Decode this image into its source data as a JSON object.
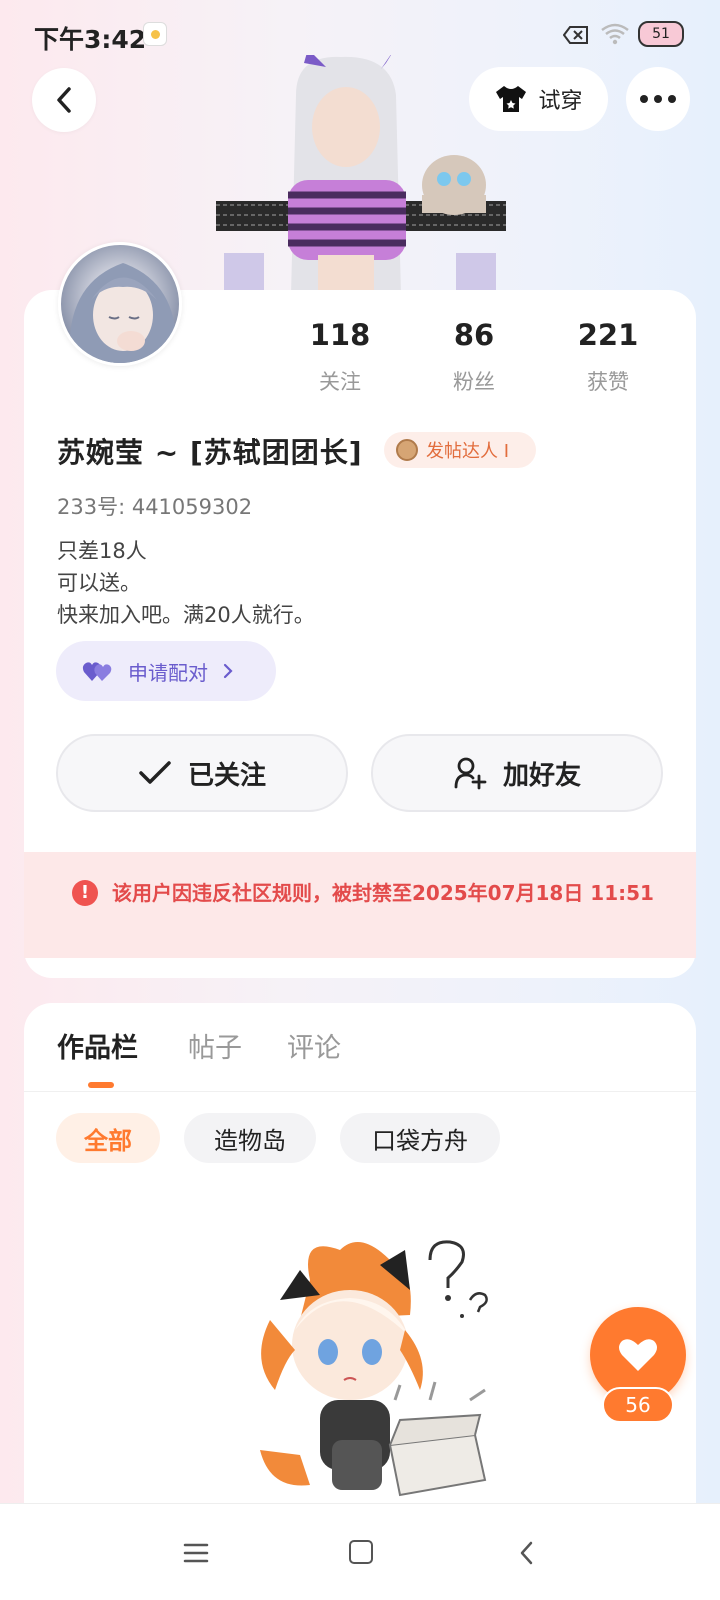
{
  "status_bar": {
    "time": "下午3:42",
    "battery": "51"
  },
  "header": {
    "tryon_label": "试穿"
  },
  "profile": {
    "stats": [
      {
        "value": "118",
        "label": "关注"
      },
      {
        "value": "86",
        "label": "粉丝"
      },
      {
        "value": "221",
        "label": "获赞"
      }
    ],
    "username": "苏婉莹 ~ [苏轼团团长]",
    "badge": "发帖达人 I",
    "uid": "233号: 441059302",
    "bio": [
      "只差18人",
      "可以送。",
      "快来加入吧。满20人就行。"
    ],
    "pair_label": "申请配对",
    "follow_label": "已关注",
    "add_friend_label": "加好友",
    "ban_notice": "该用户因违反社区规则，被封禁至2025年07月18日 11:51"
  },
  "tabs": [
    {
      "label": "作品栏",
      "active": true
    },
    {
      "label": "帖子",
      "active": false
    },
    {
      "label": "评论",
      "active": false
    }
  ],
  "filters": [
    {
      "label": "全部",
      "active": true
    },
    {
      "label": "造物岛",
      "active": false
    },
    {
      "label": "口袋方舟",
      "active": false
    }
  ],
  "like": {
    "count": "56"
  },
  "colors": {
    "accent": "#ff7a2f",
    "danger": "#e34b4b",
    "pair": "#6a5ccd"
  }
}
